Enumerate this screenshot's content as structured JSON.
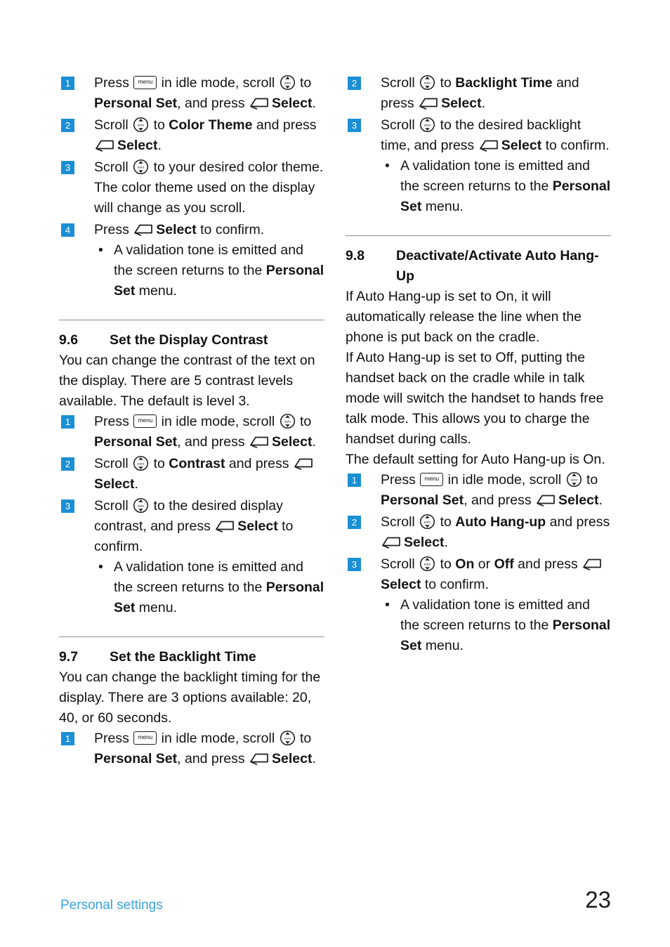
{
  "icons": {
    "menu_key": "menu",
    "nav_key": "nav-up-down-icon",
    "select_key": "soft-key-select-icon"
  },
  "left_column": {
    "steps_top": [
      {
        "num": "1",
        "parts": [
          {
            "t": "Press ",
            "s": "n"
          },
          {
            "t": "ICON_MENU",
            "s": "icon"
          },
          {
            "t": " in idle mode, scroll ",
            "s": "n"
          },
          {
            "t": "ICON_NAV",
            "s": "icon"
          },
          {
            "t": " to ",
            "s": "n"
          },
          {
            "t": "Personal Set",
            "s": "b"
          },
          {
            "t": ", and press ",
            "s": "n"
          },
          {
            "t": "ICON_SELECT",
            "s": "icon"
          },
          {
            "t": "Select",
            "s": "b"
          },
          {
            "t": ".",
            "s": "n"
          }
        ]
      },
      {
        "num": "2",
        "parts": [
          {
            "t": "Scroll ",
            "s": "n"
          },
          {
            "t": "ICON_NAV",
            "s": "icon"
          },
          {
            "t": " to ",
            "s": "n"
          },
          {
            "t": "Color Theme",
            "s": "b"
          },
          {
            "t": " and press ",
            "s": "n"
          },
          {
            "t": "ICON_SELECT",
            "s": "icon"
          },
          {
            "t": "Select",
            "s": "b"
          },
          {
            "t": ".",
            "s": "n"
          }
        ]
      },
      {
        "num": "3",
        "parts": [
          {
            "t": "Scroll ",
            "s": "n"
          },
          {
            "t": "ICON_NAV",
            "s": "icon"
          },
          {
            "t": " to your desired color theme. The color theme used on the display will change as you scroll.",
            "s": "n"
          }
        ]
      },
      {
        "num": "4",
        "parts": [
          {
            "t": "Press ",
            "s": "n"
          },
          {
            "t": "ICON_SELECT",
            "s": "icon"
          },
          {
            "t": "Select",
            "s": "b"
          },
          {
            "t": " to confirm.",
            "s": "n"
          }
        ],
        "bullets": [
          [
            {
              "t": "A validation tone is emitted and the screen returns to the ",
              "s": "n"
            },
            {
              "t": "Personal Set",
              "s": "b"
            },
            {
              "t": " menu.",
              "s": "n"
            }
          ]
        ]
      }
    ],
    "section_9_6": {
      "number": "9.6",
      "title": "Set the Display Contrast",
      "paragraphs": [
        "You can change the contrast of the text on the display. There are 5 contrast levels available. The default is level 3."
      ],
      "steps": [
        {
          "num": "1",
          "parts": [
            {
              "t": "Press ",
              "s": "n"
            },
            {
              "t": "ICON_MENU",
              "s": "icon"
            },
            {
              "t": " in idle mode, scroll ",
              "s": "n"
            },
            {
              "t": "ICON_NAV",
              "s": "icon"
            },
            {
              "t": " to ",
              "s": "n"
            },
            {
              "t": "Personal Set",
              "s": "b"
            },
            {
              "t": ", and press ",
              "s": "n"
            },
            {
              "t": "ICON_SELECT",
              "s": "icon"
            },
            {
              "t": "Select",
              "s": "b"
            },
            {
              "t": ".",
              "s": "n"
            }
          ]
        },
        {
          "num": "2",
          "parts": [
            {
              "t": "Scroll ",
              "s": "n"
            },
            {
              "t": "ICON_NAV",
              "s": "icon"
            },
            {
              "t": " to ",
              "s": "n"
            },
            {
              "t": "Contrast",
              "s": "b"
            },
            {
              "t": " and press ",
              "s": "n"
            },
            {
              "t": "ICON_SELECT",
              "s": "icon"
            },
            {
              "t": "Select",
              "s": "b"
            },
            {
              "t": ".",
              "s": "n"
            }
          ]
        },
        {
          "num": "3",
          "parts": [
            {
              "t": "Scroll ",
              "s": "n"
            },
            {
              "t": "ICON_NAV",
              "s": "icon"
            },
            {
              "t": " to the desired display contrast, and press ",
              "s": "n"
            },
            {
              "t": "ICON_SELECT",
              "s": "icon"
            },
            {
              "t": "Select",
              "s": "b"
            },
            {
              "t": " to confirm.",
              "s": "n"
            }
          ],
          "bullets": [
            [
              {
                "t": "A validation tone is emitted and the screen returns to the ",
                "s": "n"
              },
              {
                "t": "Personal Set",
                "s": "b"
              },
              {
                "t": " menu.",
                "s": "n"
              }
            ]
          ]
        }
      ]
    },
    "section_9_7": {
      "number": "9.7",
      "title": "Set the Backlight Time",
      "paragraphs": [
        "You can change the backlight timing for the display. There are 3 options available: 20, 40, or 60 seconds."
      ],
      "steps": [
        {
          "num": "1",
          "parts": [
            {
              "t": "Press ",
              "s": "n"
            },
            {
              "t": "ICON_MENU",
              "s": "icon"
            },
            {
              "t": " in idle mode, scroll ",
              "s": "n"
            },
            {
              "t": "ICON_NAV",
              "s": "icon"
            },
            {
              "t": " to ",
              "s": "n"
            },
            {
              "t": "Personal Set",
              "s": "b"
            },
            {
              "t": ", and press ",
              "s": "n"
            },
            {
              "t": "ICON_SELECT",
              "s": "icon"
            },
            {
              "t": "Select",
              "s": "b"
            },
            {
              "t": ".",
              "s": "n"
            }
          ]
        }
      ]
    }
  },
  "right_column": {
    "steps_top": [
      {
        "num": "2",
        "parts": [
          {
            "t": "Scroll ",
            "s": "n"
          },
          {
            "t": "ICON_NAV",
            "s": "icon"
          },
          {
            "t": " to ",
            "s": "n"
          },
          {
            "t": "Backlight Time",
            "s": "b"
          },
          {
            "t": " and press ",
            "s": "n"
          },
          {
            "t": "ICON_SELECT",
            "s": "icon"
          },
          {
            "t": "Select",
            "s": "b"
          },
          {
            "t": ".",
            "s": "n"
          }
        ]
      },
      {
        "num": "3",
        "parts": [
          {
            "t": "Scroll ",
            "s": "n"
          },
          {
            "t": "ICON_NAV",
            "s": "icon"
          },
          {
            "t": " to the desired backlight time, and press ",
            "s": "n"
          },
          {
            "t": "ICON_SELECT",
            "s": "icon"
          },
          {
            "t": "Select",
            "s": "b"
          },
          {
            "t": " to confirm.",
            "s": "n"
          }
        ],
        "bullets": [
          [
            {
              "t": "A validation tone is emitted and the screen returns to the ",
              "s": "n"
            },
            {
              "t": "Personal Set",
              "s": "b"
            },
            {
              "t": " menu.",
              "s": "n"
            }
          ]
        ]
      }
    ],
    "section_9_8": {
      "number": "9.8",
      "title": "Deactivate/Activate Auto Hang-Up",
      "paragraphs": [
        "If Auto Hang-up is set to On, it will automatically release the line when the phone is put back on the cradle.",
        "If Auto Hang-up is set to Off, putting the handset back on the cradle while in talk mode will switch the handset to hands free talk mode. This allows you to charge the handset during calls.",
        "The default setting for Auto Hang-up is On."
      ],
      "steps": [
        {
          "num": "1",
          "parts": [
            {
              "t": "Press ",
              "s": "n"
            },
            {
              "t": "ICON_MENU",
              "s": "icon"
            },
            {
              "t": " in idle mode, scroll ",
              "s": "n"
            },
            {
              "t": "ICON_NAV",
              "s": "icon"
            },
            {
              "t": " to ",
              "s": "n"
            },
            {
              "t": "Personal Set",
              "s": "b"
            },
            {
              "t": ", and press ",
              "s": "n"
            },
            {
              "t": "ICON_SELECT",
              "s": "icon"
            },
            {
              "t": "Select",
              "s": "b"
            },
            {
              "t": ".",
              "s": "n"
            }
          ]
        },
        {
          "num": "2",
          "parts": [
            {
              "t": "Scroll ",
              "s": "n"
            },
            {
              "t": "ICON_NAV",
              "s": "icon"
            },
            {
              "t": " to ",
              "s": "n"
            },
            {
              "t": "Auto Hang-up",
              "s": "b"
            },
            {
              "t": " and press ",
              "s": "n"
            },
            {
              "t": "ICON_SELECT",
              "s": "icon"
            },
            {
              "t": "Select",
              "s": "b"
            },
            {
              "t": ".",
              "s": "n"
            }
          ]
        },
        {
          "num": "3",
          "parts": [
            {
              "t": "Scroll ",
              "s": "n"
            },
            {
              "t": "ICON_NAV",
              "s": "icon"
            },
            {
              "t": " to ",
              "s": "n"
            },
            {
              "t": "On",
              "s": "b"
            },
            {
              "t": " or ",
              "s": "n"
            },
            {
              "t": "Off",
              "s": "b"
            },
            {
              "t": " and press ",
              "s": "n"
            },
            {
              "t": "ICON_SELECT",
              "s": "icon"
            },
            {
              "t": "Select",
              "s": "b"
            },
            {
              "t": " to confirm.",
              "s": "n"
            }
          ],
          "bullets": [
            [
              {
                "t": "A validation tone is emitted and the screen returns to the ",
                "s": "n"
              },
              {
                "t": "Personal Set",
                "s": "b"
              },
              {
                "t": " menu.",
                "s": "n"
              }
            ]
          ]
        }
      ]
    }
  },
  "footer": {
    "label": "Personal settings",
    "page_number": "23",
    "label_color": "#3aa3dd"
  }
}
